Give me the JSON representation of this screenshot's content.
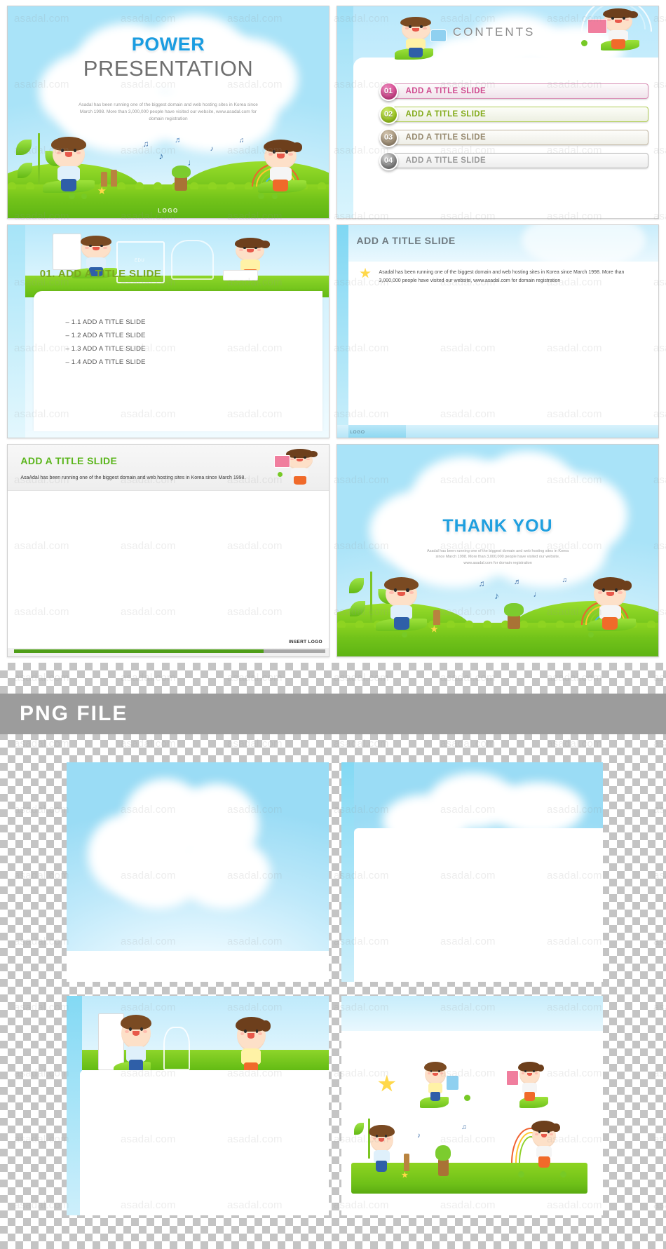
{
  "meta": {
    "watermark_text": "asadal.com"
  },
  "slides": [
    {
      "id": "title-slide",
      "title_line1": "POWER",
      "title_line2": "PRESENTATION",
      "description": "Asadal has been running one of the biggest domain and web hosting sites in Korea since March 1998. More than 3,000,000 people have visited our website,  www.asadal.com for domain registration",
      "logo_label": "LOGO"
    },
    {
      "id": "contents-slide",
      "heading": "CONTENTS",
      "items": [
        {
          "number": "01",
          "label": "ADD A TITLE SLIDE",
          "badge_color": "#d2448c",
          "text_color": "#cf4b8f",
          "bar_color": "#f2e3ec",
          "border_color": "#d98fb6"
        },
        {
          "number": "02",
          "label": "ADD A TITLE SLIDE",
          "badge_color": "#9bc81e",
          "text_color": "#83ab1b",
          "bar_color": "#eef0e4",
          "border_color": "#b2cf58"
        },
        {
          "number": "03",
          "label": "ADD A TITLE SLIDE",
          "badge_color": "#a08f76",
          "text_color": "#978a6f",
          "bar_color": "#efeee9",
          "border_color": "#c2b7a3"
        },
        {
          "number": "04",
          "label": "ADD A TITLE SLIDE",
          "badge_color": "#8c8c8c",
          "text_color": "#9a9a9a",
          "bar_color": "#efefef",
          "border_color": "#bdbdbd"
        }
      ]
    },
    {
      "id": "section-slide",
      "heading": "01. ADD A TITLE SLIDE",
      "bullets": [
        "– 1.1 ADD A TITLE SLIDE",
        "– 1.2 ADD A TITLE SLIDE",
        "– 1.3 ADD A TITLE SLIDE",
        "– 1.4 ADD A TITLE SLIDE"
      ],
      "board_letters": "EDU"
    },
    {
      "id": "content-slide-blue",
      "title": "ADD A TITLE SLIDE",
      "body": "Asadal has been running one of the biggest domain and web hosting sites in Korea since March 1998. More than 3,000,000 people have visited our website, www.asadal.com for domain registration",
      "logo_label": "LOGO"
    },
    {
      "id": "content-slide-grey",
      "title": "ADD A TITLE SLIDE",
      "body": "AsaAdal has been running one of the biggest domain and web hosting sites in Korea since March 1998.",
      "insert_logo_label": "INSERT LOGO"
    },
    {
      "id": "thankyou-slide",
      "title": "THANK YOU",
      "description": "Asadal has been running one of the biggest domain and web hosting sites in Korea since March 1998. More than 3,000,000 people have visited our website,  www.asadal.com for domain registration"
    }
  ],
  "png_section": {
    "banner_title": "PNG FILE",
    "banner_color": "#9c9c9c",
    "thumbnails": [
      {
        "id": "png-cloud-bg",
        "caption": ""
      },
      {
        "id": "png-cloud-panel-bg",
        "caption": ""
      },
      {
        "id": "png-kids-board-bg",
        "caption": ""
      },
      {
        "id": "png-characters-set",
        "caption": ""
      }
    ]
  },
  "colors": {
    "sky_blue": "#a9e3f8",
    "grass_green": "#72c31a",
    "title_blue": "#1b9ce0",
    "title_grey": "#6f6f6f",
    "accent_green": "#7aa81e",
    "banner_grey": "#9c9c9c"
  }
}
